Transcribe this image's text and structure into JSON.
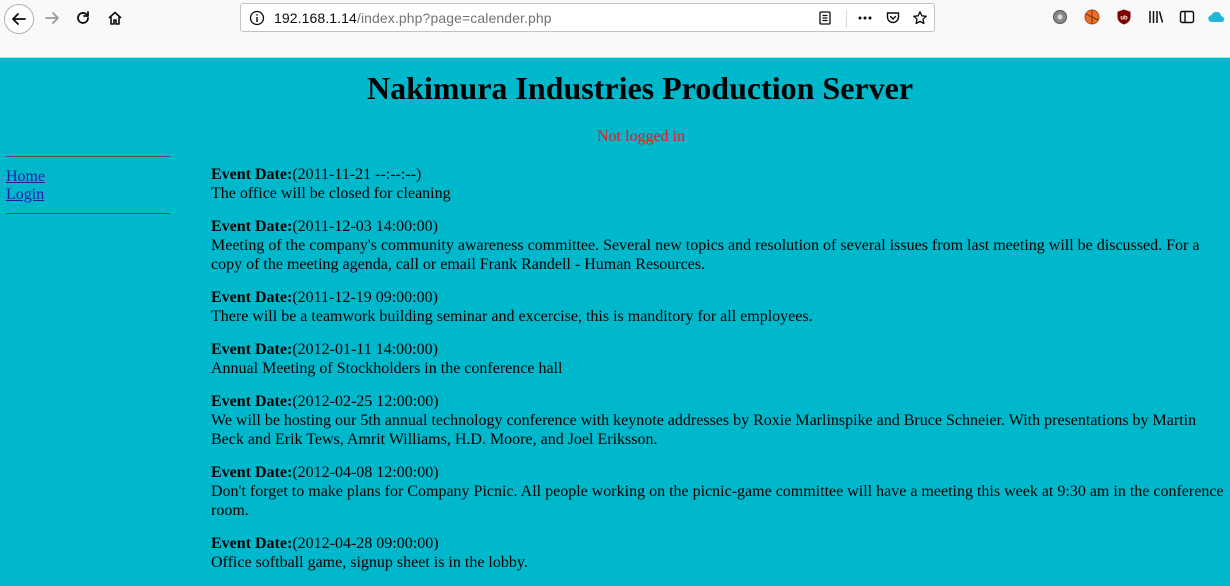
{
  "browser": {
    "url_host": "192.168.1.14",
    "url_path": "/index.php?page=calender.php"
  },
  "site": {
    "title": "Nakimura Industries Production Server",
    "login_status": "Not logged in"
  },
  "sidebar": {
    "items": [
      {
        "label": "Home"
      },
      {
        "label": "Login"
      }
    ]
  },
  "events": [
    {
      "label": "Event Date:",
      "date": "(2011-11-21 --:--:--)",
      "text": "The office will be closed for cleaning"
    },
    {
      "label": "Event Date:",
      "date": "(2011-12-03 14:00:00)",
      "text": "Meeting of the company's community awareness committee. Several new topics and resolution of several issues from last meeting will be discussed. For a copy of the meeting agenda, call or email Frank Randell - Human Resources."
    },
    {
      "label": "Event Date:",
      "date": "(2011-12-19 09:00:00)",
      "text": "There will be a teamwork building seminar and excercise, this is manditory for all employees."
    },
    {
      "label": "Event Date:",
      "date": "(2012-01-11 14:00:00)",
      "text": "Annual Meeting of Stockholders in the conference hall"
    },
    {
      "label": "Event Date:",
      "date": "(2012-02-25 12:00:00)",
      "text": "We will be hosting our 5th annual technology conference with keynote addresses by Roxie Marlinspike and Bruce Schneier. With presentations by Martin Beck and Erik Tews, Amrit Williams, H.D. Moore, and Joel Eriksson."
    },
    {
      "label": "Event Date:",
      "date": "(2012-04-08 12:00:00)",
      "text": "Don't forget to make plans for Company Picnic. All people working on the picnic-game committee will have a meeting this week at 9:30 am in the conference room."
    },
    {
      "label": "Event Date:",
      "date": "(2012-04-28 09:00:00)",
      "text": "Office softball game, signup sheet is in the lobby."
    }
  ],
  "colors": {
    "page_background": "#00b8cc",
    "status_text": "#e21b1b",
    "link": "#2a1aa6"
  }
}
